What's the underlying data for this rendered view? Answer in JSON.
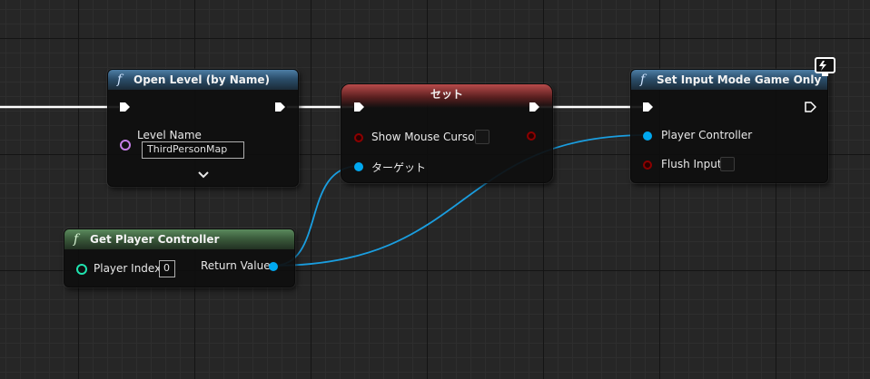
{
  "colors": {
    "exec_wire": "#ffffff",
    "object_pin": "#00a8f0",
    "bool_pin": "#8c0000",
    "string_pin": "#ec3fd2",
    "int_pin": "#1fe3af"
  },
  "nodes": {
    "open_level": {
      "title": "Open Level (by Name)",
      "icon": "function-icon",
      "level_name_label": "Level Name",
      "level_name_value": "ThirdPersonMap",
      "expand_icon": "chevron-down-icon"
    },
    "set_node": {
      "title": "セット",
      "show_mouse_cursor_label": "Show Mouse Cursor",
      "show_mouse_cursor_checked": false,
      "target_label": "ターゲット"
    },
    "set_input_mode": {
      "title": "Set Input Mode Game Only",
      "icon": "function-icon",
      "badge_icon": "monitor-lightning-icon",
      "player_controller_label": "Player Controller",
      "flush_input_label": "Flush Input",
      "flush_input_checked": false
    },
    "get_player_controller": {
      "title": "Get Player Controller",
      "icon": "function-icon",
      "player_index_label": "Player Index",
      "player_index_value": "0",
      "return_value_label": "Return Value"
    }
  }
}
